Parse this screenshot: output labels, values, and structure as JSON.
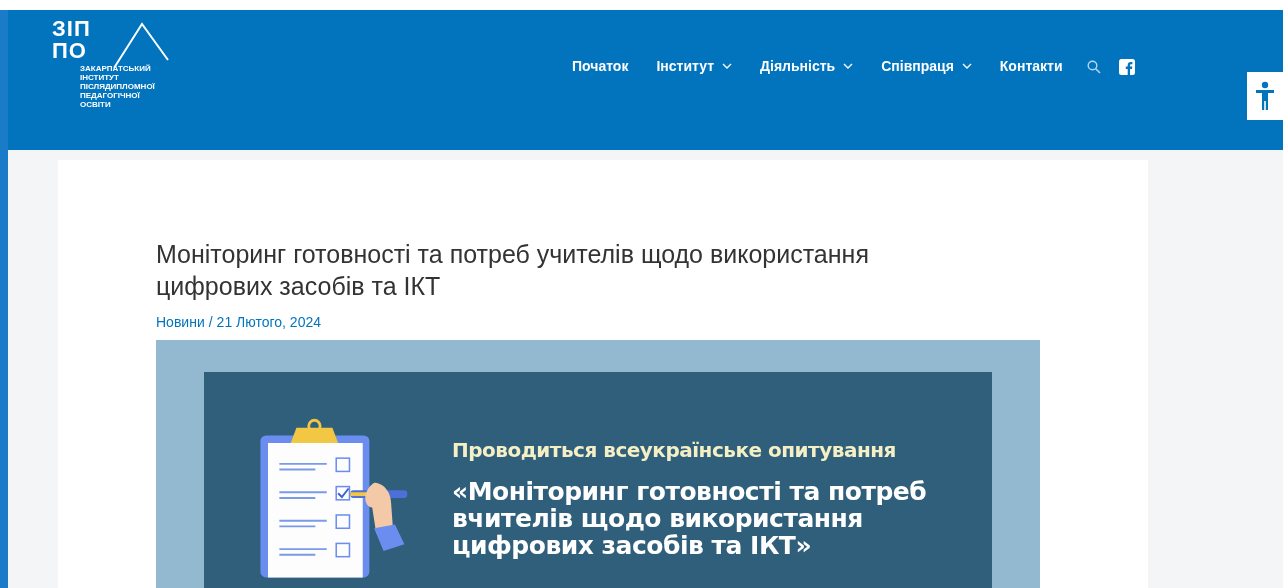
{
  "logo": {
    "mark_top": "ЗІП",
    "mark_bottom": "ПО",
    "lines": [
      "ЗАКАРПАТСЬКИЙ",
      "ІНСТИТУТ",
      "ПІСЛЯДИПЛОМНОЇ",
      "ПЕДАГОГІЧНОЇ",
      "ОСВІТИ"
    ]
  },
  "nav": [
    {
      "label": "Початок",
      "dropdown": false
    },
    {
      "label": "Інститут",
      "dropdown": true
    },
    {
      "label": "Діяльність",
      "dropdown": true
    },
    {
      "label": "Співпраця",
      "dropdown": true
    },
    {
      "label": "Контакти",
      "dropdown": false
    }
  ],
  "post": {
    "title": "Моніторинг готовності та потреб учителів щодо використання цифрових засобів та ІКТ",
    "category": "Новини",
    "separator": "/",
    "date": "21 Лютого, 2024",
    "banner": {
      "kicker": "Проводиться всеукраїнське опитування",
      "headline": "«Моніторинг готовності та потреб вчителів щодо використання цифрових засобів та ІКТ»",
      "checklist": [
        false,
        true,
        false,
        false
      ]
    }
  }
}
